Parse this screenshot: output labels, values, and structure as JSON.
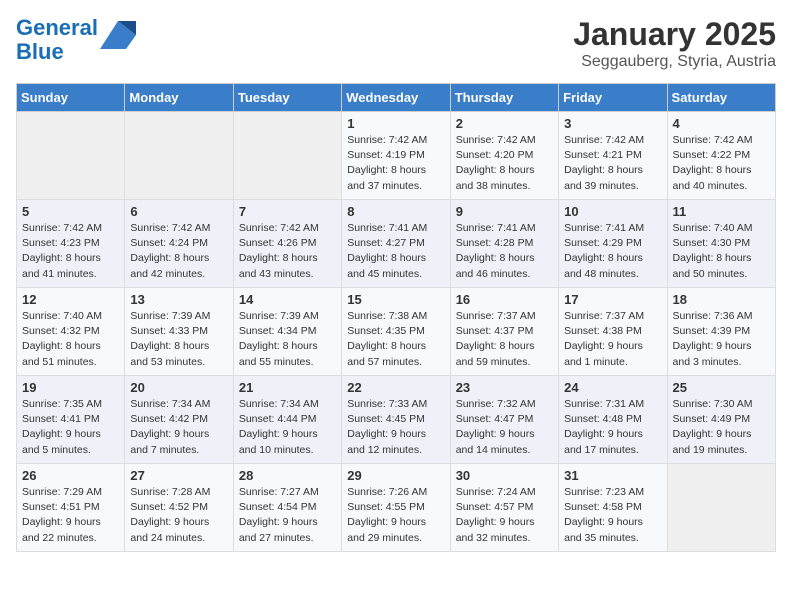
{
  "header": {
    "logo_line1": "General",
    "logo_line2": "Blue",
    "title": "January 2025",
    "subtitle": "Seggauberg, Styria, Austria"
  },
  "days_of_week": [
    "Sunday",
    "Monday",
    "Tuesday",
    "Wednesday",
    "Thursday",
    "Friday",
    "Saturday"
  ],
  "weeks": [
    [
      {
        "day": "",
        "info": ""
      },
      {
        "day": "",
        "info": ""
      },
      {
        "day": "",
        "info": ""
      },
      {
        "day": "1",
        "info": "Sunrise: 7:42 AM\nSunset: 4:19 PM\nDaylight: 8 hours\nand 37 minutes."
      },
      {
        "day": "2",
        "info": "Sunrise: 7:42 AM\nSunset: 4:20 PM\nDaylight: 8 hours\nand 38 minutes."
      },
      {
        "day": "3",
        "info": "Sunrise: 7:42 AM\nSunset: 4:21 PM\nDaylight: 8 hours\nand 39 minutes."
      },
      {
        "day": "4",
        "info": "Sunrise: 7:42 AM\nSunset: 4:22 PM\nDaylight: 8 hours\nand 40 minutes."
      }
    ],
    [
      {
        "day": "5",
        "info": "Sunrise: 7:42 AM\nSunset: 4:23 PM\nDaylight: 8 hours\nand 41 minutes."
      },
      {
        "day": "6",
        "info": "Sunrise: 7:42 AM\nSunset: 4:24 PM\nDaylight: 8 hours\nand 42 minutes."
      },
      {
        "day": "7",
        "info": "Sunrise: 7:42 AM\nSunset: 4:26 PM\nDaylight: 8 hours\nand 43 minutes."
      },
      {
        "day": "8",
        "info": "Sunrise: 7:41 AM\nSunset: 4:27 PM\nDaylight: 8 hours\nand 45 minutes."
      },
      {
        "day": "9",
        "info": "Sunrise: 7:41 AM\nSunset: 4:28 PM\nDaylight: 8 hours\nand 46 minutes."
      },
      {
        "day": "10",
        "info": "Sunrise: 7:41 AM\nSunset: 4:29 PM\nDaylight: 8 hours\nand 48 minutes."
      },
      {
        "day": "11",
        "info": "Sunrise: 7:40 AM\nSunset: 4:30 PM\nDaylight: 8 hours\nand 50 minutes."
      }
    ],
    [
      {
        "day": "12",
        "info": "Sunrise: 7:40 AM\nSunset: 4:32 PM\nDaylight: 8 hours\nand 51 minutes."
      },
      {
        "day": "13",
        "info": "Sunrise: 7:39 AM\nSunset: 4:33 PM\nDaylight: 8 hours\nand 53 minutes."
      },
      {
        "day": "14",
        "info": "Sunrise: 7:39 AM\nSunset: 4:34 PM\nDaylight: 8 hours\nand 55 minutes."
      },
      {
        "day": "15",
        "info": "Sunrise: 7:38 AM\nSunset: 4:35 PM\nDaylight: 8 hours\nand 57 minutes."
      },
      {
        "day": "16",
        "info": "Sunrise: 7:37 AM\nSunset: 4:37 PM\nDaylight: 8 hours\nand 59 minutes."
      },
      {
        "day": "17",
        "info": "Sunrise: 7:37 AM\nSunset: 4:38 PM\nDaylight: 9 hours\nand 1 minute."
      },
      {
        "day": "18",
        "info": "Sunrise: 7:36 AM\nSunset: 4:39 PM\nDaylight: 9 hours\nand 3 minutes."
      }
    ],
    [
      {
        "day": "19",
        "info": "Sunrise: 7:35 AM\nSunset: 4:41 PM\nDaylight: 9 hours\nand 5 minutes."
      },
      {
        "day": "20",
        "info": "Sunrise: 7:34 AM\nSunset: 4:42 PM\nDaylight: 9 hours\nand 7 minutes."
      },
      {
        "day": "21",
        "info": "Sunrise: 7:34 AM\nSunset: 4:44 PM\nDaylight: 9 hours\nand 10 minutes."
      },
      {
        "day": "22",
        "info": "Sunrise: 7:33 AM\nSunset: 4:45 PM\nDaylight: 9 hours\nand 12 minutes."
      },
      {
        "day": "23",
        "info": "Sunrise: 7:32 AM\nSunset: 4:47 PM\nDaylight: 9 hours\nand 14 minutes."
      },
      {
        "day": "24",
        "info": "Sunrise: 7:31 AM\nSunset: 4:48 PM\nDaylight: 9 hours\nand 17 minutes."
      },
      {
        "day": "25",
        "info": "Sunrise: 7:30 AM\nSunset: 4:49 PM\nDaylight: 9 hours\nand 19 minutes."
      }
    ],
    [
      {
        "day": "26",
        "info": "Sunrise: 7:29 AM\nSunset: 4:51 PM\nDaylight: 9 hours\nand 22 minutes."
      },
      {
        "day": "27",
        "info": "Sunrise: 7:28 AM\nSunset: 4:52 PM\nDaylight: 9 hours\nand 24 minutes."
      },
      {
        "day": "28",
        "info": "Sunrise: 7:27 AM\nSunset: 4:54 PM\nDaylight: 9 hours\nand 27 minutes."
      },
      {
        "day": "29",
        "info": "Sunrise: 7:26 AM\nSunset: 4:55 PM\nDaylight: 9 hours\nand 29 minutes."
      },
      {
        "day": "30",
        "info": "Sunrise: 7:24 AM\nSunset: 4:57 PM\nDaylight: 9 hours\nand 32 minutes."
      },
      {
        "day": "31",
        "info": "Sunrise: 7:23 AM\nSunset: 4:58 PM\nDaylight: 9 hours\nand 35 minutes."
      },
      {
        "day": "",
        "info": ""
      }
    ]
  ]
}
